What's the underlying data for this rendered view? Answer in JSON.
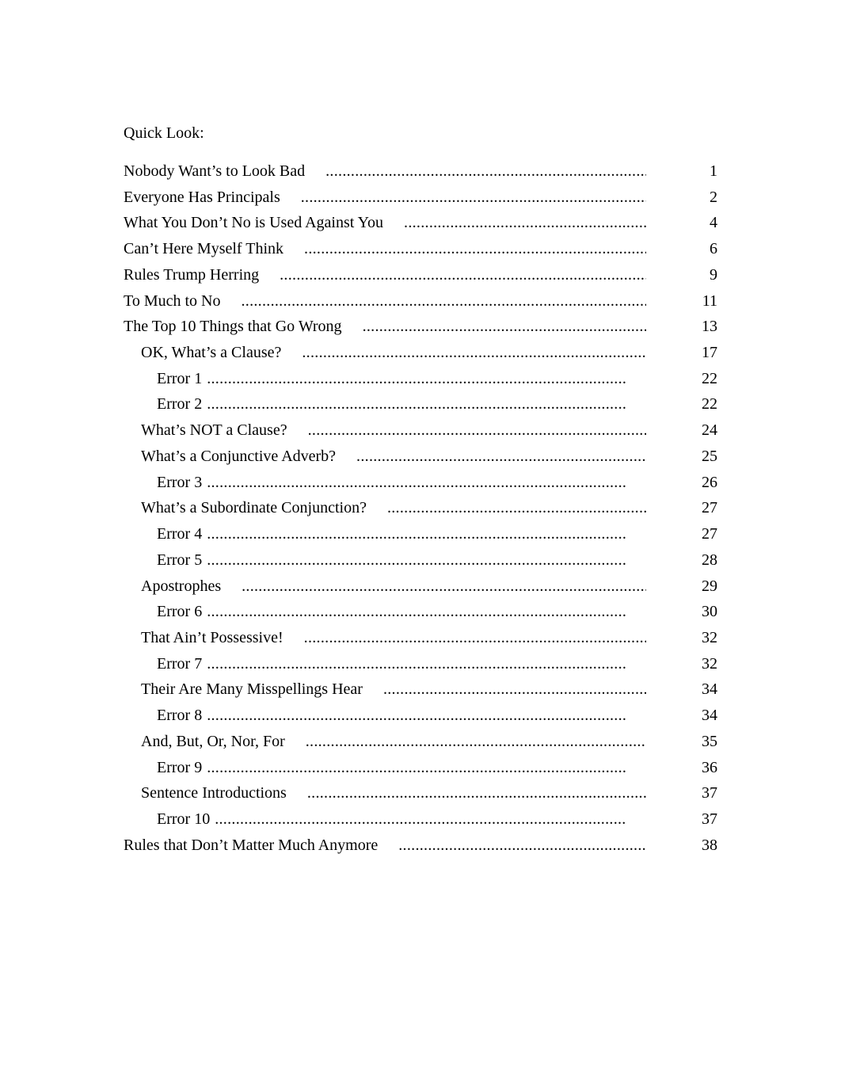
{
  "title": "Quick Look:",
  "entries": [
    {
      "label": "Nobody Want’s to Look Bad",
      "page": "1",
      "level": 0
    },
    {
      "label": "Everyone Has Principals",
      "page": "2",
      "level": 0
    },
    {
      "label": "What You Don’t No is Used Against You",
      "page": "4",
      "level": 0
    },
    {
      "label": "Can’t Here Myself Think",
      "page": "6",
      "level": 0
    },
    {
      "label": "Rules Trump Herring",
      "page": "9",
      "level": 0
    },
    {
      "label": "To Much to No",
      "page": "11",
      "level": 0
    },
    {
      "label": "The Top 10 Things that Go Wrong",
      "page": "13",
      "level": 0
    },
    {
      "label": "OK, What’s a Clause?",
      "page": "17",
      "level": 1
    },
    {
      "label": "Error 1",
      "page": "22",
      "level": 2
    },
    {
      "label": "Error 2",
      "page": "22",
      "level": 2
    },
    {
      "label": "What’s NOT a Clause?",
      "page": "24",
      "level": 1
    },
    {
      "label": "What’s a  Conjunctive Adverb?",
      "page": "25",
      "level": 1
    },
    {
      "label": "Error 3",
      "page": "26",
      "level": 2
    },
    {
      "label": "What’s a Subordinate Conjunction?",
      "page": "27",
      "level": 1
    },
    {
      "label": "Error 4",
      "page": "27",
      "level": 2
    },
    {
      "label": "Error 5",
      "page": "28",
      "level": 2
    },
    {
      "label": "Apostrophes",
      "page": "29",
      "level": 1
    },
    {
      "label": "Error 6",
      "page": "30",
      "level": 2
    },
    {
      "label": "That Ain’t Possessive!",
      "page": "32",
      "level": 1
    },
    {
      "label": "Error 7",
      "page": "32",
      "level": 2
    },
    {
      "label": "Their Are Many Misspellings Hear",
      "page": "34",
      "level": 1
    },
    {
      "label": "Error 8",
      "page": "34",
      "level": 2
    },
    {
      "label": "And, But, Or, Nor, For",
      "page": "35",
      "level": 1
    },
    {
      "label": "Error 9",
      "page": "36",
      "level": 2
    },
    {
      "label": "Sentence Introductions",
      "page": "37",
      "level": 1
    },
    {
      "label": "Error 10",
      "page": "37",
      "level": 2
    },
    {
      "label": "Rules that Don’t Matter Much Anymore",
      "page": "38",
      "level": 0
    }
  ]
}
